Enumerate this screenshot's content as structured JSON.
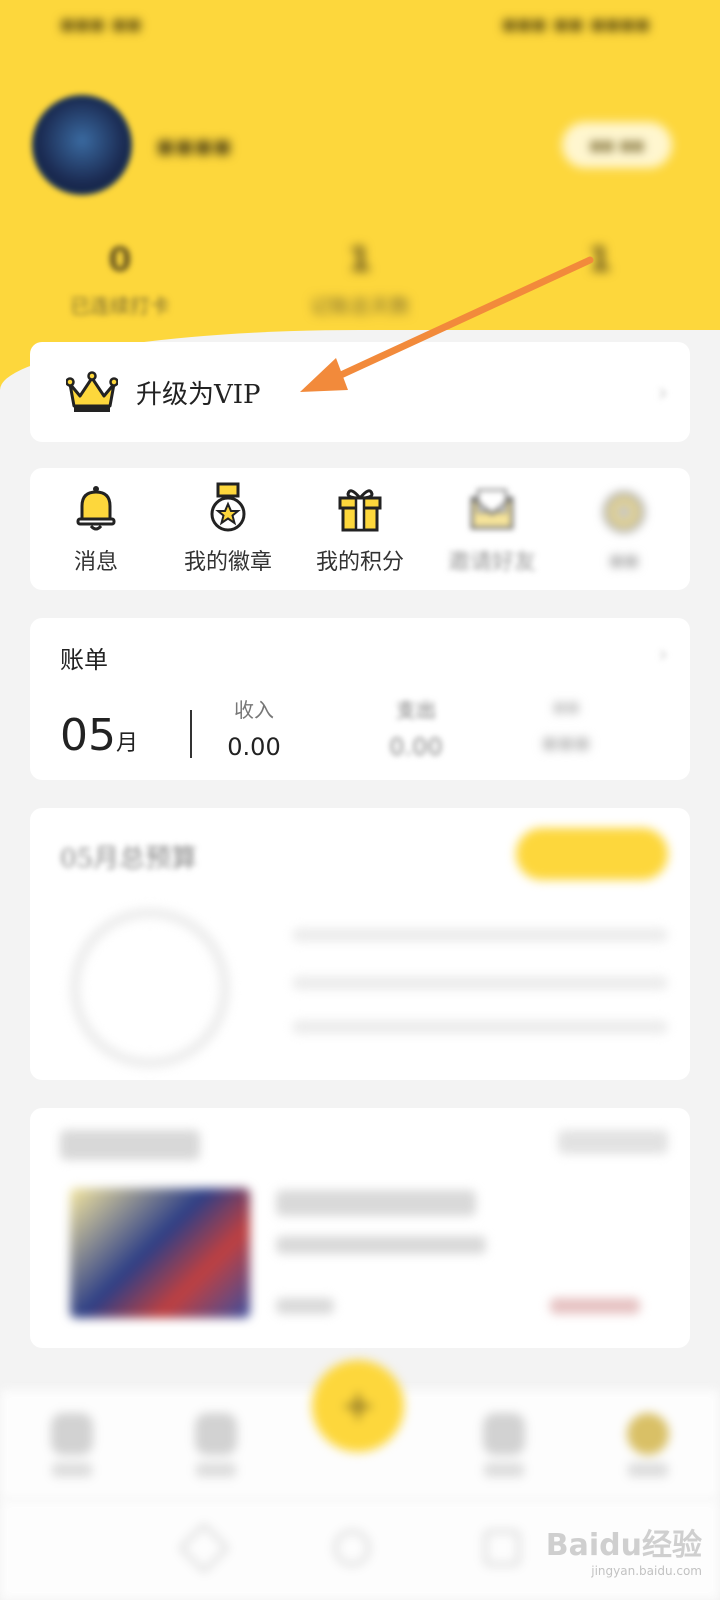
{
  "colors": {
    "accent": "#fdd73c",
    "arrow": "#f28a3b",
    "background": "#f3f3f3"
  },
  "vip": {
    "label": "升级为VIP",
    "icon": "crown-icon"
  },
  "stats": [
    {
      "value": "0",
      "label": "已连续打卡"
    },
    {
      "value": "1",
      "label": "记账总天数"
    },
    {
      "value": "1",
      "label": ""
    }
  ],
  "quick": [
    {
      "label": "消息",
      "icon": "bell-icon"
    },
    {
      "label": "我的徽章",
      "icon": "medal-icon"
    },
    {
      "label": "我的积分",
      "icon": "gift-icon"
    },
    {
      "label": "邀请好友",
      "icon": "envelope-icon"
    },
    {
      "label": "",
      "icon": "settings-icon"
    }
  ],
  "bill": {
    "title": "账单",
    "month": "05",
    "month_unit": "月",
    "income_label": "收入",
    "income_value": "0.00",
    "expense_label": "支出",
    "expense_value": "0.00"
  },
  "budget": {
    "title": "05月总预算"
  },
  "watermark": {
    "brand": "Baidu经验",
    "url": "jingyan.baidu.com"
  }
}
